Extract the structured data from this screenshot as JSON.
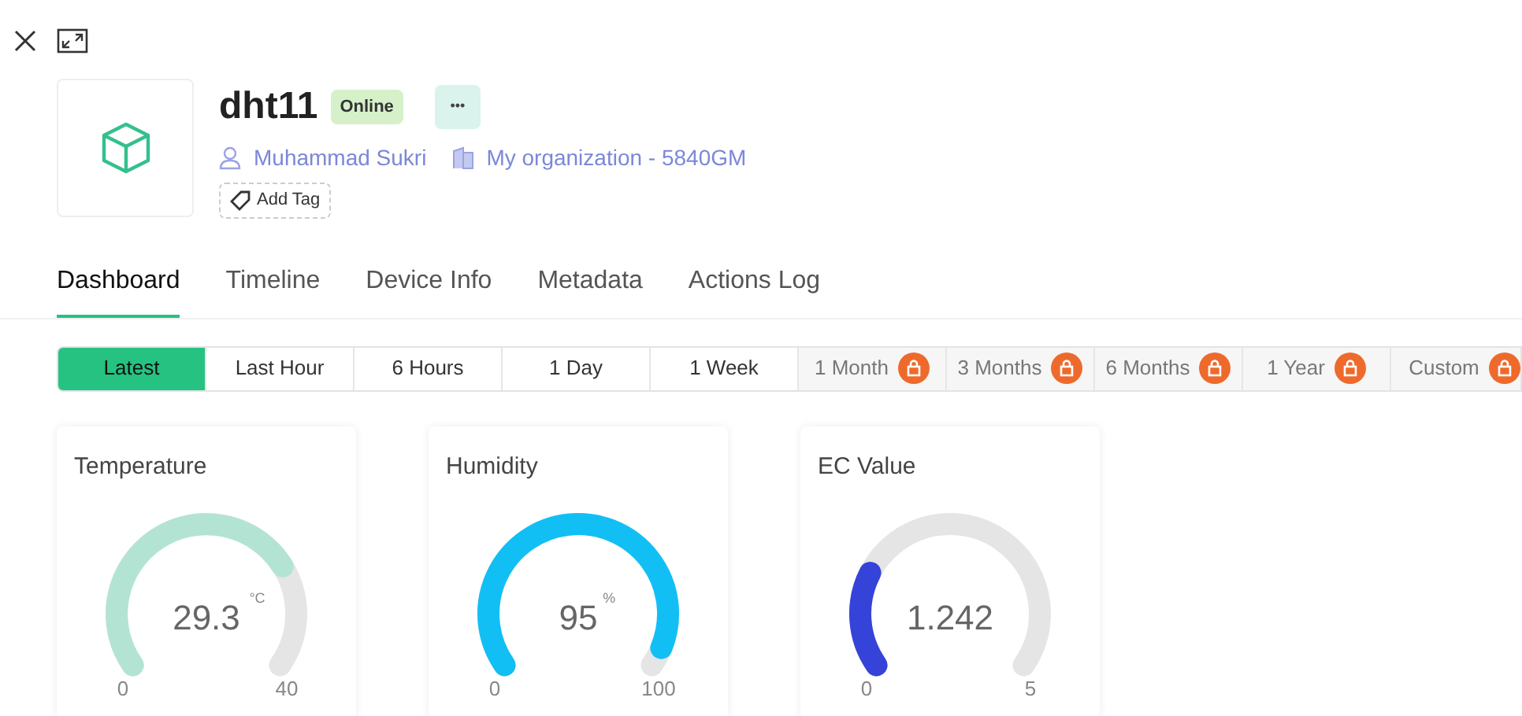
{
  "device": {
    "name": "dht11",
    "status": "Online",
    "owner": "Muhammad Sukri",
    "organization": "My organization - 5840GM",
    "add_tag": "Add Tag",
    "more": "•••"
  },
  "tabs": [
    {
      "label": "Dashboard",
      "selected": true
    },
    {
      "label": "Timeline",
      "selected": false
    },
    {
      "label": "Device Info",
      "selected": false
    },
    {
      "label": "Metadata",
      "selected": false
    },
    {
      "label": "Actions Log",
      "selected": false
    }
  ],
  "ranges": [
    {
      "label": "Latest",
      "selected": true,
      "locked": false
    },
    {
      "label": "Last Hour",
      "selected": false,
      "locked": false
    },
    {
      "label": "6 Hours",
      "selected": false,
      "locked": false
    },
    {
      "label": "1 Day",
      "selected": false,
      "locked": false
    },
    {
      "label": "1 Week",
      "selected": false,
      "locked": false
    },
    {
      "label": "1 Month",
      "selected": false,
      "locked": true
    },
    {
      "label": "3 Months",
      "selected": false,
      "locked": true
    },
    {
      "label": "6 Months",
      "selected": false,
      "locked": true
    },
    {
      "label": "1 Year",
      "selected": false,
      "locked": true
    },
    {
      "label": "Custom",
      "selected": false,
      "locked": true
    }
  ],
  "gauges": [
    {
      "title": "Temperature",
      "value": "29.3",
      "unit": "°C",
      "min": "0",
      "max": "40",
      "color": "#b3e4d3"
    },
    {
      "title": "Humidity",
      "value": "95",
      "unit": "%",
      "min": "0",
      "max": "100",
      "color": "#12bff5"
    },
    {
      "title": "EC Value",
      "value": "1.242",
      "min": "0",
      "max": "5",
      "color": "#3543d9"
    }
  ]
}
